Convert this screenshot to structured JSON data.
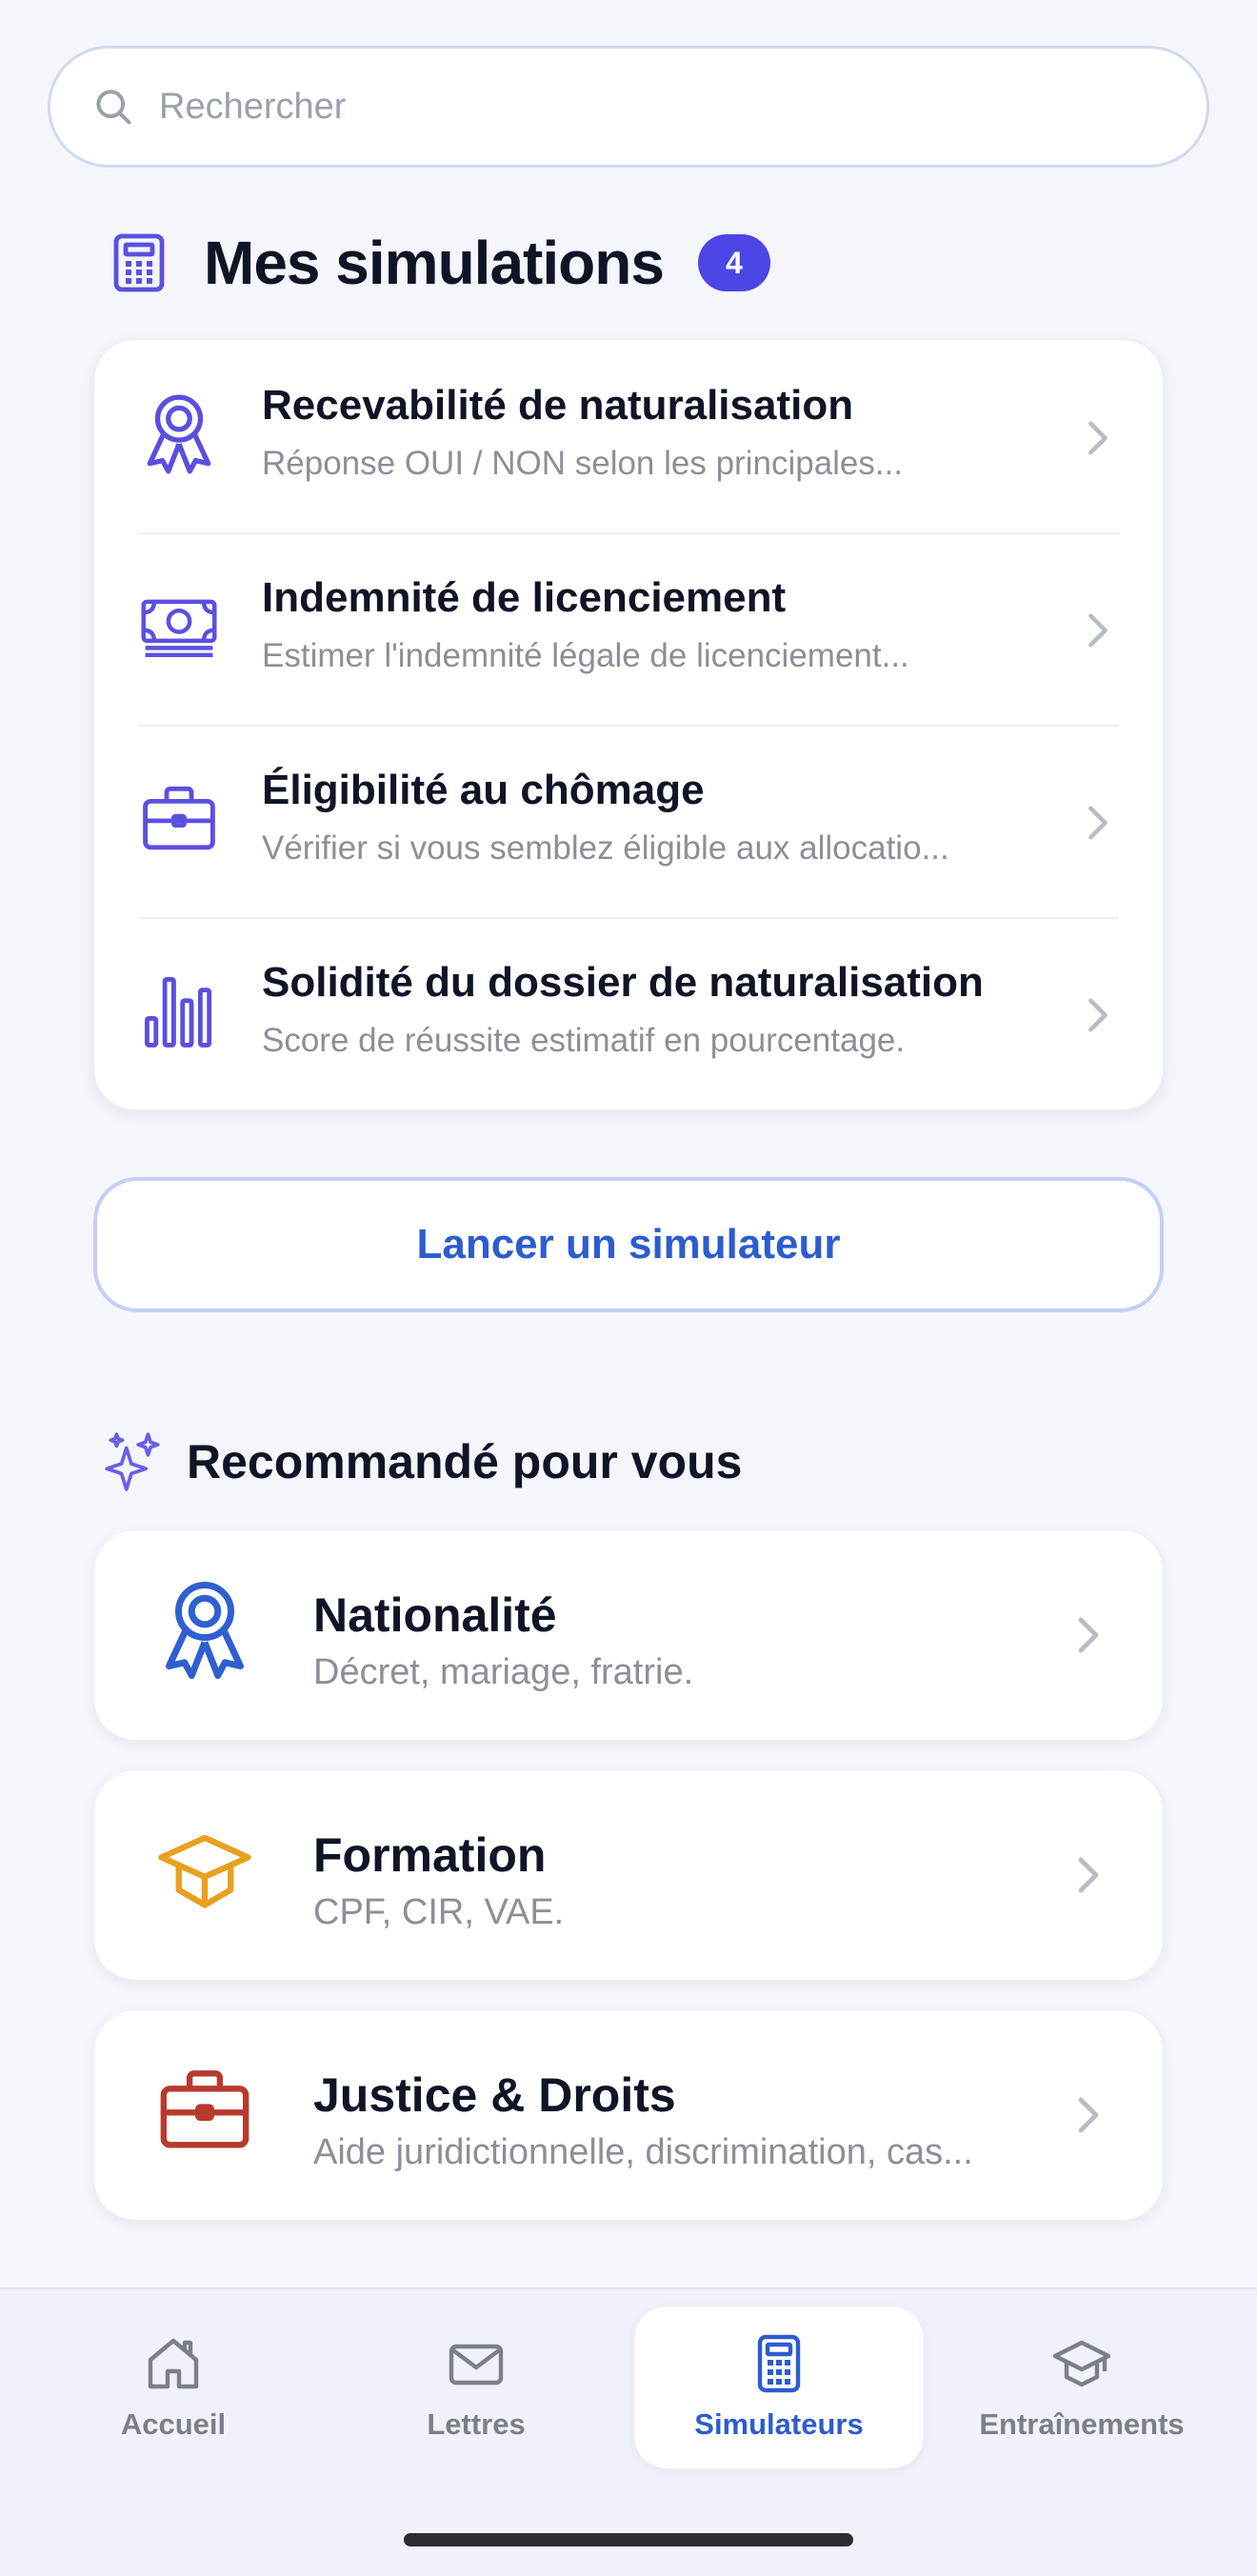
{
  "search": {
    "placeholder": "Rechercher"
  },
  "simulations": {
    "title": "Mes simulations",
    "count": "4",
    "items": [
      {
        "icon": "award-ribbon-icon",
        "title": "Recevabilité de naturalisation",
        "subtitle": "Réponse OUI / NON selon les principales..."
      },
      {
        "icon": "banknote-icon",
        "title": "Indemnité de licenciement",
        "subtitle": "Estimer l'indemnité légale de licenciement..."
      },
      {
        "icon": "briefcase-icon",
        "title": "Éligibilité au chômage",
        "subtitle": "Vérifier si vous semblez éligible aux allocatio..."
      },
      {
        "icon": "bar-chart-icon",
        "title": "Solidité du dossier de naturalisation",
        "subtitle": "Score de réussite estimatif en pourcentage."
      }
    ],
    "launch_label": "Lancer un simulateur"
  },
  "recommended": {
    "title": "Recommandé pour vous",
    "items": [
      {
        "icon": "award-ribbon-icon",
        "title": "Nationalité",
        "subtitle": "Décret, mariage, fratrie."
      },
      {
        "icon": "graduation-cap-icon",
        "title": "Formation",
        "subtitle": "CPF, CIR, VAE."
      },
      {
        "icon": "briefcase-icon",
        "title": "Justice & Droits",
        "subtitle": "Aide juridictionnelle, discrimination, cas..."
      }
    ]
  },
  "tabbar": {
    "tabs": [
      {
        "label": "Accueil",
        "icon": "home-icon"
      },
      {
        "label": "Lettres",
        "icon": "envelope-icon"
      },
      {
        "label": "Simulateurs",
        "icon": "calculator-icon",
        "active": true
      },
      {
        "label": "Entraînements",
        "icon": "graduation-cap-icon"
      }
    ]
  },
  "colors": {
    "accent": "#4b46e5",
    "link_blue": "#2c5ccf",
    "icon_purple": "#5b4fe0",
    "nationalite_blue": "#2f5fd0",
    "formation_orange": "#e8a020",
    "justice_red": "#b83a2c"
  }
}
